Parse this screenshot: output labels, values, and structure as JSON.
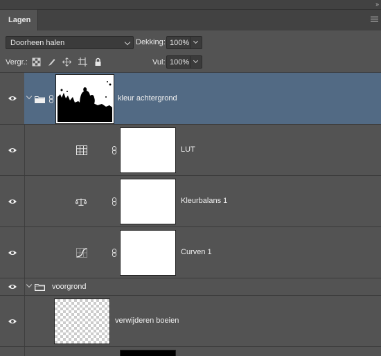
{
  "panel": {
    "tab_label": "Lagen",
    "collapse_glyph": "››"
  },
  "blend": {
    "mode": "Doorheen halen",
    "opacity_label": "Dekking:",
    "opacity_value": "100%"
  },
  "lock": {
    "label": "Vergr.:",
    "fill_label": "Vul:",
    "fill_value": "100%"
  },
  "layers": [
    {
      "name": "kleur achtergrond",
      "type": "group",
      "selected": true,
      "expanded": true
    },
    {
      "name": "LUT",
      "type": "adjustment",
      "icon": "grid-lut-icon"
    },
    {
      "name": "Kleurbalans 1",
      "type": "adjustment",
      "icon": "color-balance-icon"
    },
    {
      "name": "Curven 1",
      "type": "adjustment",
      "icon": "curves-icon"
    },
    {
      "name": "voorgrond",
      "type": "group",
      "expanded": true
    },
    {
      "name": "verwijderen boeien",
      "type": "pixel",
      "thumbnail": "transparent-checker"
    }
  ],
  "colors": {
    "panel_bg": "#535353",
    "selection": "#526a84",
    "tabbar_bg": "#424242"
  }
}
